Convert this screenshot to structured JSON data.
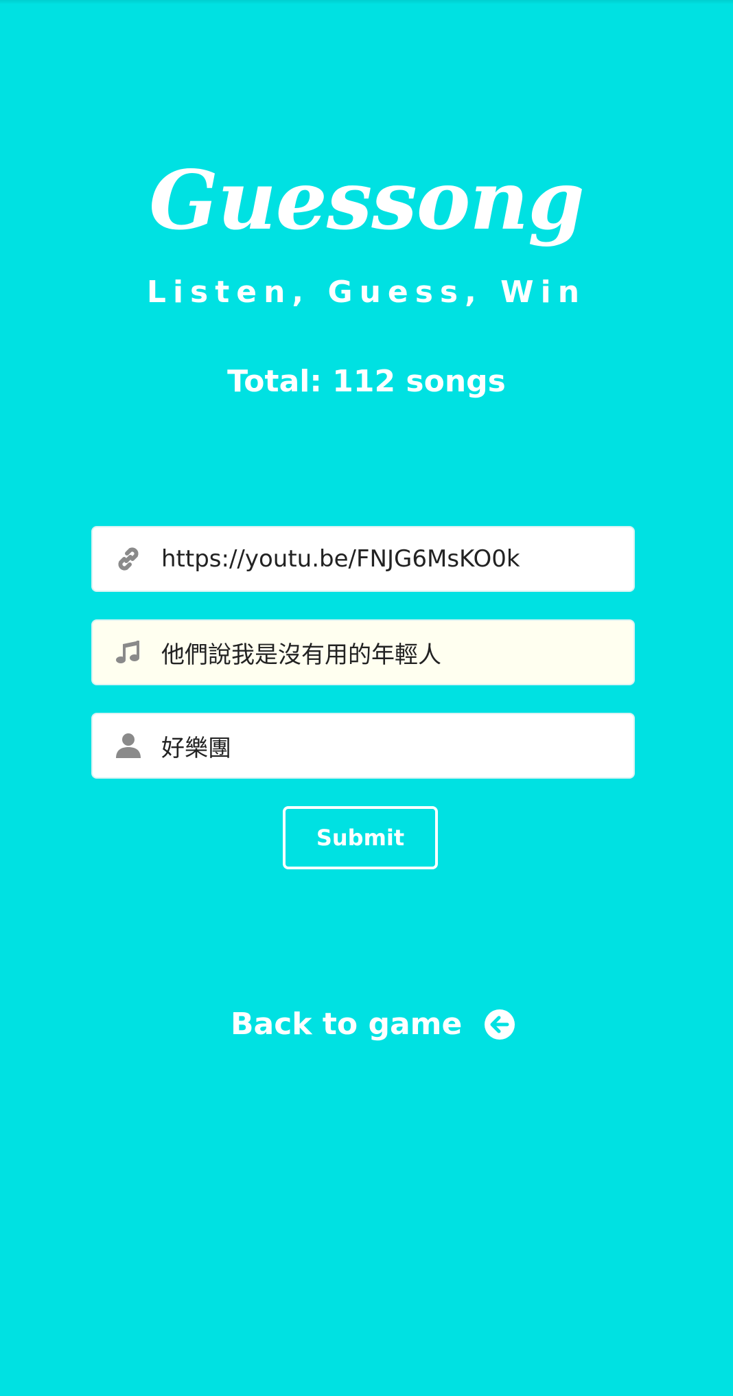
{
  "app": {
    "logo": "Guessong",
    "tagline": "Listen, Guess, Win",
    "total": "Total: 112 songs"
  },
  "form": {
    "link": {
      "icon": "link-icon",
      "value": "https://youtu.be/FNJG6MsKO0k"
    },
    "song": {
      "icon": "music-note-icon",
      "value": "他們說我是沒有用的年輕人"
    },
    "artist": {
      "icon": "user-icon",
      "value": "好樂團"
    },
    "submit_label": "Submit"
  },
  "nav": {
    "back_label": "Back to game",
    "back_icon": "arrow-left-circle-icon"
  },
  "colors": {
    "background": "#00e1e2",
    "text": "#ffffff",
    "field_bg": "#ffffff",
    "field_highlight_bg": "#fffff0",
    "icon": "#8a8a8a"
  }
}
